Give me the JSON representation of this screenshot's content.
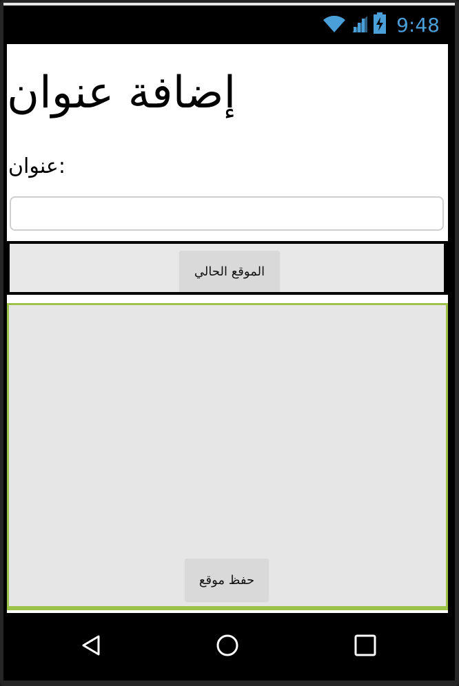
{
  "status_bar": {
    "time": "9:48",
    "icons": [
      "wifi-icon",
      "cell-signal-icon",
      "battery-charging-icon"
    ],
    "accent_color": "#4a9fd8"
  },
  "page": {
    "title": "إضافة عنوان",
    "address_label": "عنوان:",
    "address_input": {
      "value": "",
      "placeholder": ""
    },
    "current_location_button": "الموقع الحالي",
    "save_location_button": "حفظ موقع",
    "map_border_color": "#9cc24a"
  },
  "nav_bar": {
    "icons": [
      "back-icon",
      "home-icon",
      "recent-apps-icon"
    ]
  }
}
